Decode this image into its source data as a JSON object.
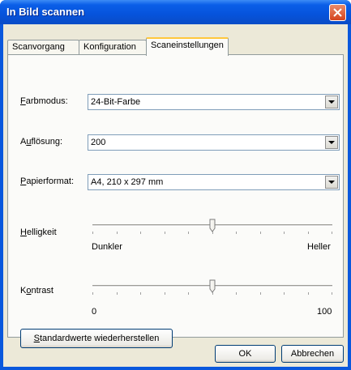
{
  "window": {
    "title": "In Bild scannen"
  },
  "tabs": [
    {
      "label": "Scanvorgang"
    },
    {
      "label": "Konfiguration"
    },
    {
      "label": "Scaneinstellungen"
    }
  ],
  "color_mode": {
    "label": "Farbmodus:",
    "value": "24-Bit-Farbe"
  },
  "resolution": {
    "label": "Auflösung:",
    "value": "200"
  },
  "paper_size": {
    "label": "Papierformat:",
    "value": "A4, 210 x 297 mm"
  },
  "brightness": {
    "label": "Helligkeit",
    "min_label": "Dunkler",
    "max_label": "Heller",
    "level": 0.5
  },
  "contrast": {
    "label": "Kontrast",
    "min_label": "0",
    "max_label": "100",
    "level": 0.5
  },
  "buttons": {
    "restore_defaults": "Standardwerte wiederherstellen",
    "ok": "OK",
    "cancel": "Abbrechen"
  },
  "colors": {
    "title_bar": "#0a5ee8",
    "close_button": "#d4431d",
    "dialog_bg": "#ece9d8"
  }
}
